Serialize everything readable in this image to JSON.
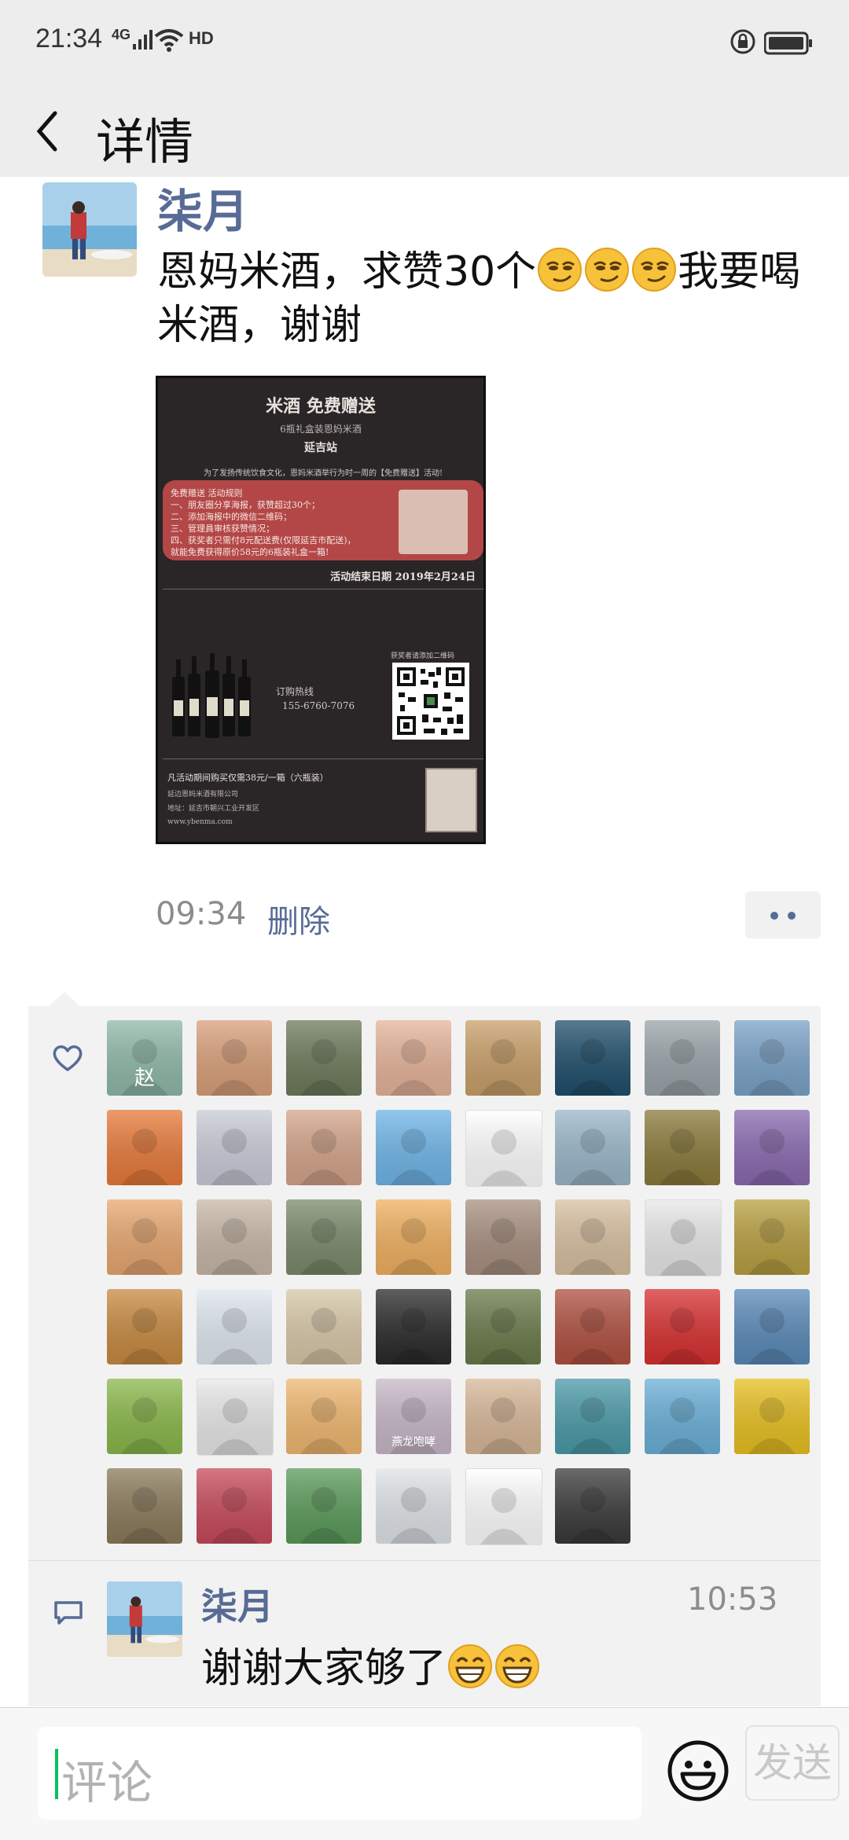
{
  "status_bar": {
    "time": "21:34",
    "network": "4G",
    "hd": "HD",
    "icons": [
      "signal-icon",
      "wifi-icon",
      "lock-rotation-icon",
      "battery-icon"
    ]
  },
  "nav": {
    "title": "详情",
    "back_icon": "chevron-left-icon"
  },
  "post": {
    "username": "柒月",
    "text_part1": "恩妈米酒，求赞30个",
    "text_part2": "我要喝米酒，谢谢",
    "emoji_count": 3,
    "time": "09:34",
    "delete_label": "删除",
    "more_icon": "more-dots-icon",
    "poster": {
      "title": "米酒 免费赠送",
      "subtitle": "6瓶礼盒装恩妈米酒",
      "city": "延吉站",
      "intro": "为了发扬传统饮食文化，恩妈米酒举行为时一周的【免费赠送】活动!",
      "rules": [
        "免费赠送 活动规则",
        "一、朋友圈分享海报，获赞超过30个；",
        "二、添加海报中的微信二维码；",
        "三、管理員审核获赞情况；",
        "四、获奖者只需付8元配送费(仅限延吉市配送)，",
        "    就能免费获得原价58元的6瓶装礼盒一箱!"
      ],
      "end_date": "活动结束日期 2019年2月24日",
      "hotline_label": "订购热线",
      "hotline": "155-6760-7076",
      "qr_caption": "获奖者请添加二维码",
      "price_line": "凡活动期间购买仅需38元/一箱（六瓶装）",
      "company": "延边恩妈米酒有限公司",
      "address": "地址：延吉市朝兴工业开发区",
      "website": "www.ybenma.com"
    }
  },
  "likes": {
    "icon": "heart-icon",
    "avatars": [
      {
        "bg": "#8fb9a8",
        "label": "赵"
      },
      {
        "bg": "#d9a07a"
      },
      {
        "bg": "#6d7a5a"
      },
      {
        "bg": "#e6b49a"
      },
      {
        "bg": "#c9a06a"
      },
      {
        "bg": "#1f4e6b"
      },
      {
        "bg": "#9aa4aa"
      },
      {
        "bg": "#7aa3c8"
      },
      {
        "bg": "#e87a3a"
      },
      {
        "bg": "#c9ccd8"
      },
      {
        "bg": "#d4a48a"
      },
      {
        "bg": "#6fb6e8"
      },
      {
        "bg": "#ffffff"
      },
      {
        "bg": "#9ab7c9"
      },
      {
        "bg": "#8a7a3a"
      },
      {
        "bg": "#8a6ab0"
      },
      {
        "bg": "#e8a870"
      },
      {
        "bg": "#c8b8a8"
      },
      {
        "bg": "#7a8a6a"
      },
      {
        "bg": "#f0b060"
      },
      {
        "bg": "#a89080"
      },
      {
        "bg": "#d8c0a0"
      },
      {
        "bg": "#e8e8e8"
      },
      {
        "bg": "#b8a040"
      },
      {
        "bg": "#c88a40"
      },
      {
        "bg": "#e0e8f0"
      },
      {
        "bg": "#d8c8a8"
      },
      {
        "bg": "#2a2a2a"
      },
      {
        "bg": "#6a7a4a"
      },
      {
        "bg": "#b05040"
      },
      {
        "bg": "#d83030"
      },
      {
        "bg": "#5a8ab8"
      },
      {
        "bg": "#8ab84a"
      },
      {
        "bg": "#e8e8e8"
      },
      {
        "bg": "#f0b870"
      },
      {
        "bg": "#c8b8c8",
        "label": "燕龙咆哮"
      },
      {
        "bg": "#d8b898"
      },
      {
        "bg": "#4a9aa8"
      },
      {
        "bg": "#6ab0d8"
      },
      {
        "bg": "#e8c020"
      },
      {
        "bg": "#8a7a5a"
      },
      {
        "bg": "#c84a5a"
      },
      {
        "bg": "#5a9a5a"
      },
      {
        "bg": "#e0e4e8"
      },
      {
        "bg": "#ffffff"
      },
      {
        "bg": "#3a3a3a"
      }
    ]
  },
  "comment": {
    "icon": "comment-icon",
    "username": "柒月",
    "time": "10:53",
    "text": "谢谢大家够了",
    "emoji_count": 2
  },
  "input": {
    "placeholder": "评论",
    "emoji_icon": "emoji-face-icon",
    "send_label": "发送"
  }
}
